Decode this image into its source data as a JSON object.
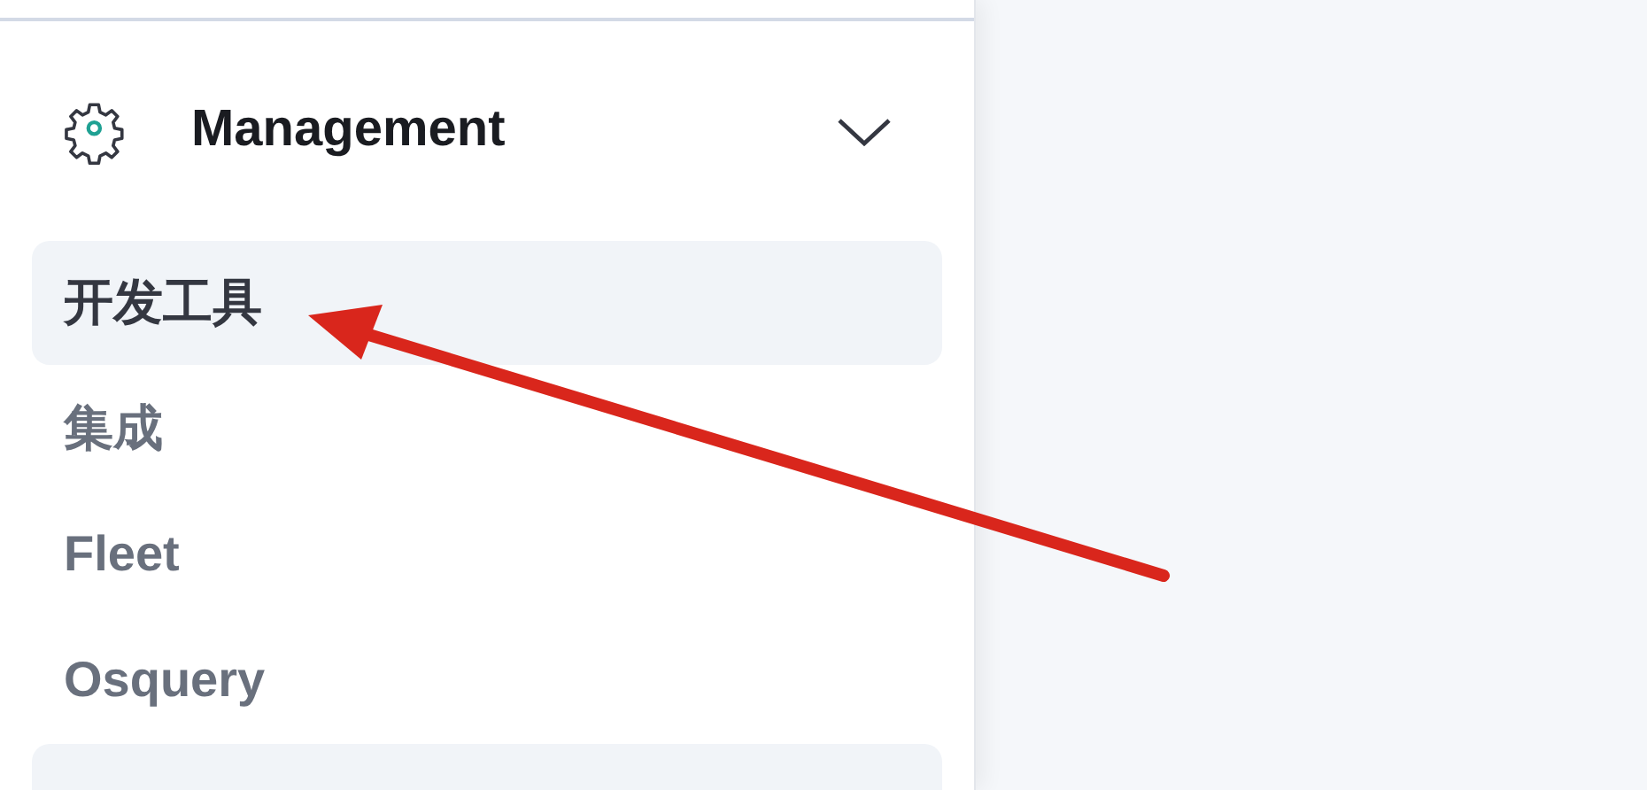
{
  "section": {
    "title": "Management",
    "expanded": true
  },
  "items": [
    {
      "label": "开发工具",
      "highlighted": true
    },
    {
      "label": "集成",
      "highlighted": false
    },
    {
      "label": "Fleet",
      "highlighted": false
    },
    {
      "label": "Osquery",
      "highlighted": false
    },
    {
      "highlighted": true
    }
  ]
}
